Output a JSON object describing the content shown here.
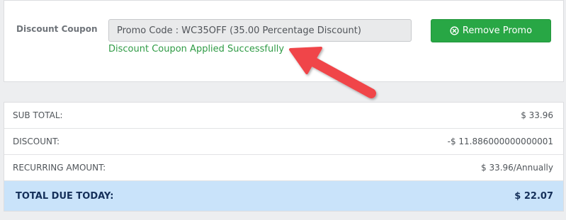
{
  "coupon": {
    "label": "Discount Coupon",
    "promo_value": "Promo Code : WC35OFF (35.00 Percentage Discount)",
    "success_message": "Discount Coupon Applied Successfully",
    "remove_button_label": "Remove Promo",
    "remove_icon": "circle-x-icon"
  },
  "annotation": {
    "arrow_color": "#f0454a",
    "arrow_icon": "pointer-arrow-icon"
  },
  "totals": {
    "rows": [
      {
        "label": "SUB TOTAL:",
        "value": "$ 33.96"
      },
      {
        "label": "DISCOUNT:",
        "value": "-$ 11.886000000000001"
      },
      {
        "label": "RECURRING AMOUNT:",
        "value": "$ 33.96/Annually"
      }
    ],
    "total_label": "TOTAL DUE TODAY:",
    "total_value": "$ 22.07"
  },
  "colors": {
    "accent_green": "#28a745",
    "success_text": "#2f9b45",
    "total_bg": "#c9e3fa",
    "total_text": "#15305a"
  }
}
